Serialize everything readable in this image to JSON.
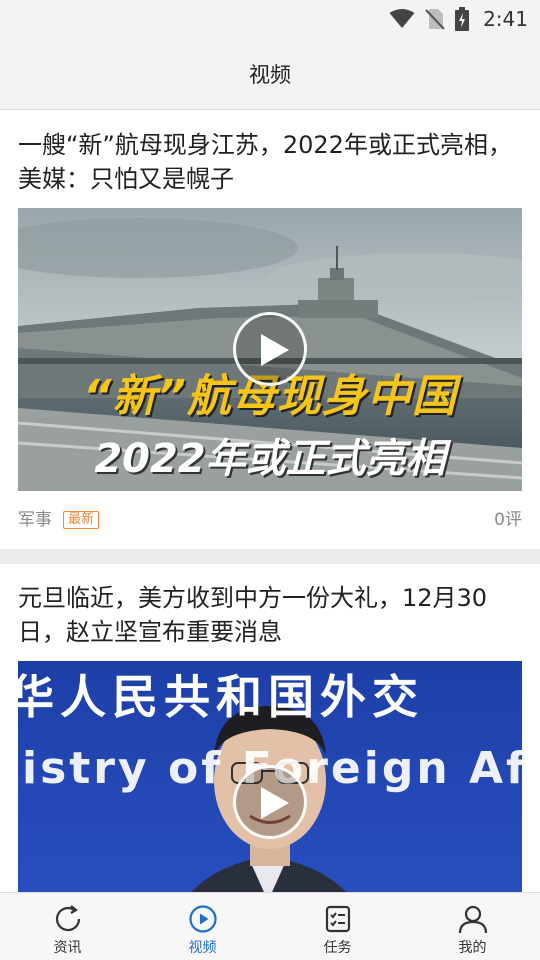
{
  "status_bar": {
    "time": "2:41"
  },
  "header": {
    "title": "视频"
  },
  "articles": [
    {
      "title": "一艘“新”航母现身江苏，2022年或正式亮相，美媒：只怕又是幌子",
      "overlay_line1": "“新”航母现身中国",
      "overlay_line2": "2022年或正式亮相",
      "category": "军事",
      "badge": "最新",
      "comments": "0评"
    },
    {
      "title": "元旦临近，美方收到中方一份大礼，12月30日，赵立坚宣布重要消息",
      "banner_line1": "华人民共和国外交",
      "banner_line2": "istry of Foreign Af"
    }
  ],
  "bottom_nav": {
    "items": [
      {
        "label": "资讯",
        "icon": "refresh-icon"
      },
      {
        "label": "视频",
        "icon": "play-circle-icon",
        "active": true
      },
      {
        "label": "任务",
        "icon": "checklist-icon"
      },
      {
        "label": "我的",
        "icon": "user-icon"
      }
    ]
  },
  "colors": {
    "accent": "#1f6fc8",
    "badge": "#f08a3c",
    "header_bg": "#f3f3f3"
  }
}
